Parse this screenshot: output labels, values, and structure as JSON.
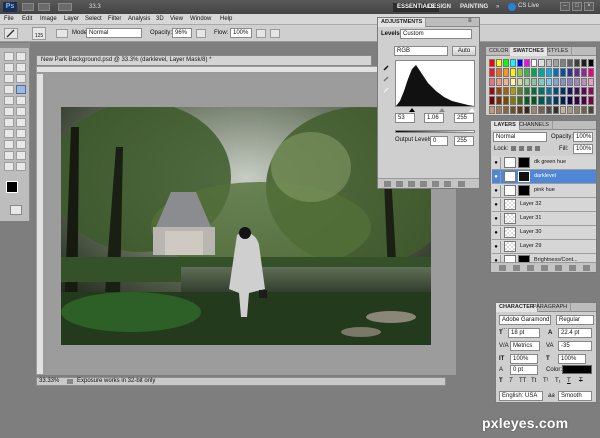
{
  "app": {
    "logo": "Ps",
    "zoom_display": "33.3",
    "workspaces": [
      "ESSENTIALS",
      "DESIGN",
      "PAINTING"
    ],
    "cs_live": "CS Live",
    "menu": [
      "File",
      "Edit",
      "Image",
      "Layer",
      "Select",
      "Filter",
      "Analysis",
      "3D",
      "View",
      "Window",
      "Help"
    ]
  },
  "options": {
    "brush_size": "125",
    "mode_label": "Mode:",
    "mode_value": "Normal",
    "opacity_label": "Opacity:",
    "opacity_value": "96%",
    "flow_label": "Flow:",
    "flow_value": "100%"
  },
  "document": {
    "tab_title": "New Park Background.psd @ 33.3% (darklevel, Layer Mask/8) *",
    "status_zoom": "33.33%",
    "status_text": "Exposure works in 32-bit only"
  },
  "adjustments": {
    "title": "ADJUSTMENTS",
    "subtitle": "Levels",
    "preset_value": "Custom",
    "channel": "RGB",
    "auto_label": "Auto",
    "input_black": "53",
    "input_gamma": "1.06",
    "input_white": "255",
    "output_label": "Output Levels:",
    "output_black": "0",
    "output_white": "255"
  },
  "swatches": {
    "tabs": [
      "COLOR",
      "SWATCHES",
      "STYLES"
    ],
    "active_tab": "SWATCHES",
    "colors": [
      "#ff0000",
      "#ffff00",
      "#00ff00",
      "#00ffff",
      "#0000ff",
      "#ff00ff",
      "#ffffff",
      "#e0e0e0",
      "#c0c0c0",
      "#a0a0a0",
      "#808080",
      "#606060",
      "#404040",
      "#202020",
      "#000000",
      "#ed1c24",
      "#f26522",
      "#f7941d",
      "#fff200",
      "#8dc63f",
      "#39b54a",
      "#00a651",
      "#00a99d",
      "#00aeef",
      "#0072bc",
      "#0054a6",
      "#2e3192",
      "#662d91",
      "#92278f",
      "#ec008c",
      "#f26d7d",
      "#f69679",
      "#fbad82",
      "#fff799",
      "#c4df9b",
      "#a3d39c",
      "#82ca9c",
      "#7accc8",
      "#6dcff6",
      "#7da7d8",
      "#8393ca",
      "#8781bd",
      "#a186be",
      "#bd8cbf",
      "#f49ac1",
      "#9e0b0f",
      "#a0410d",
      "#a36209",
      "#aba000",
      "#598527",
      "#1a7b30",
      "#007236",
      "#00746b",
      "#0076a3",
      "#004b80",
      "#003471",
      "#1b1464",
      "#440e62",
      "#630460",
      "#9e005d",
      "#790000",
      "#7b2e00",
      "#7d4900",
      "#827b00",
      "#406618",
      "#005e20",
      "#005826",
      "#005952",
      "#005b7f",
      "#003663",
      "#002157",
      "#0d004c",
      "#32004b",
      "#4b0049",
      "#7b0046",
      "#c69c6d",
      "#a67c52",
      "#8c6239",
      "#754c24",
      "#603813",
      "#3c2415",
      "#998675",
      "#736357",
      "#534741",
      "#362f2d",
      "#c7b299",
      "#a99a86",
      "#8b7d6c",
      "#6e6154",
      "#4e443c"
    ]
  },
  "layers": {
    "tabs": [
      "LAYERS",
      "CHANNELS"
    ],
    "active_tab": "LAYERS",
    "blend_mode": "Normal",
    "opacity_label": "Opacity:",
    "opacity_value": "100%",
    "lock_label": "Lock:",
    "fill_label": "Fill:",
    "fill_value": "100%",
    "rows": [
      {
        "name": "dk green hue",
        "selected": false
      },
      {
        "name": "darklevel",
        "selected": true
      },
      {
        "name": "pink hue",
        "selected": false
      },
      {
        "name": "Layer 32",
        "selected": false
      },
      {
        "name": "Layer 31",
        "selected": false
      },
      {
        "name": "Layer 30",
        "selected": false
      },
      {
        "name": "Layer 29",
        "selected": false
      },
      {
        "name": "Brightness/Cont...",
        "selected": false
      }
    ]
  },
  "character": {
    "tabs": [
      "CHARACTER",
      "PARAGRAPH"
    ],
    "active_tab": "CHARACTER",
    "font_family": "Adobe Garamond ...",
    "font_style": "Regular",
    "font_size": "18 pt",
    "leading": "22.4 pt",
    "kerning": "Metrics",
    "tracking": "-35",
    "vscale": "100%",
    "hscale": "100%",
    "baseline": "0 pt",
    "color_label": "Color:",
    "language": "English: USA",
    "antialias": "Smooth",
    "aa_prefix": "aa"
  },
  "watermark": "pxleyes.com"
}
